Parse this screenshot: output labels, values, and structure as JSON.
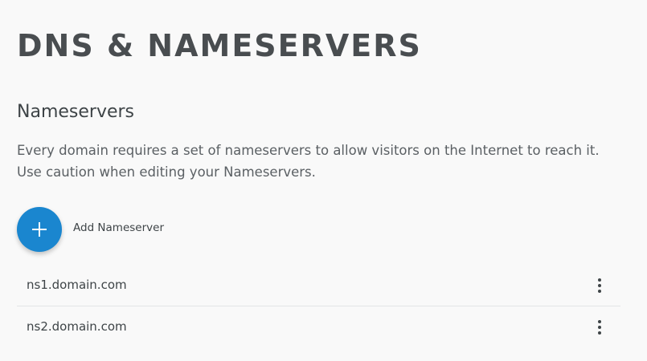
{
  "header": {
    "title": "DNS & NAMESERVERS"
  },
  "nameservers_section": {
    "title": "Nameservers",
    "description": "Every domain requires a set of nameservers to allow visitors on the Internet to reach it. Use caution when editing your Nameservers.",
    "add_button_icon": "plus-icon",
    "add_label": "Add Nameserver",
    "accent_color": "#1a86cf",
    "rows": [
      {
        "name": "ns1.domain.com",
        "menu_icon": "more-vertical-icon"
      },
      {
        "name": "ns2.domain.com",
        "menu_icon": "more-vertical-icon"
      }
    ]
  }
}
